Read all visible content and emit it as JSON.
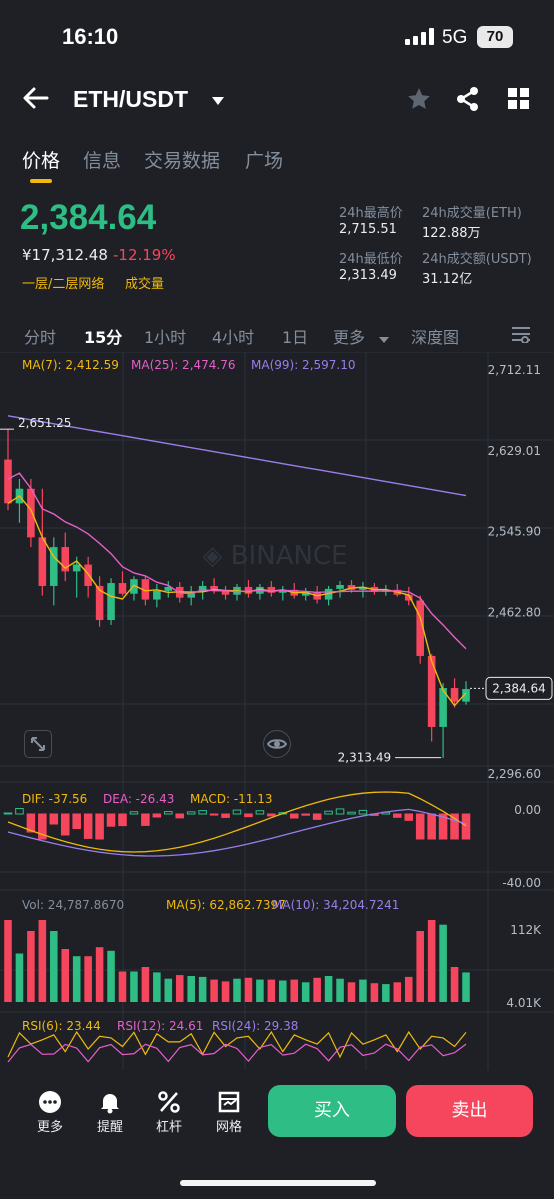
{
  "status": {
    "time": "16:10",
    "network": "5G",
    "battery": "70"
  },
  "header": {
    "pair": "ETH/USDT"
  },
  "tabs": [
    "价格",
    "信息",
    "交易数据",
    "广场"
  ],
  "price": {
    "last": "2,384.64",
    "cny": "¥17,312.48",
    "change": "-12.19%",
    "tag_layer": "一层/二层网络",
    "tag_volume": "成交量"
  },
  "stats": {
    "high_label": "24h最高价",
    "high": "2,715.51",
    "vol_eth_label": "24h成交量(ETH)",
    "vol_eth": "122.88万",
    "low_label": "24h最低价",
    "low": "2,313.49",
    "vol_usdt_label": "24h成交额(USDT)",
    "vol_usdt": "31.12亿"
  },
  "intervals": [
    "分时",
    "15分",
    "1小时",
    "4小时",
    "1日",
    "更多",
    "深度图"
  ],
  "indicators": {
    "ma7": "MA(7): 2,412.59",
    "ma25": "MA(25): 2,474.76",
    "ma99": "MA(99): 2,597.10",
    "dif": "DIF: -37.56",
    "dea": "DEA: -26.43",
    "macd": "MACD: -11.13",
    "vol": "Vol: 24,787.8670",
    "vol_ma5": "MA(5): 62,862.7397",
    "vol_ma10": "MA(10): 34,204.7241",
    "rsi6": "RSI(6): 23.44",
    "rsi12": "RSI(12): 24.61",
    "rsi24": "RSI(24): 29.38"
  },
  "colors": {
    "up": "#2ebd85",
    "down": "#f6465d",
    "ma7": "#f0b90b",
    "ma25": "#e75fc8",
    "ma99": "#9a7ee8"
  },
  "chart_data": {
    "type": "candlestick",
    "y_ticks": [
      "2,712.11",
      "2,629.01",
      "2,545.90",
      "2,462.80",
      "2,296.60"
    ],
    "ylim": [
      2296.6,
      2712.11
    ],
    "last_price_tag": "2,384.64",
    "high_marker": "2,651.25",
    "low_marker": "2,313.49",
    "candles": [
      [
        2620,
        2651,
        2568,
        2575
      ],
      [
        2575,
        2600,
        2555,
        2590
      ],
      [
        2590,
        2600,
        2530,
        2540
      ],
      [
        2540,
        2590,
        2480,
        2490
      ],
      [
        2490,
        2540,
        2470,
        2530
      ],
      [
        2530,
        2545,
        2495,
        2505
      ],
      [
        2505,
        2520,
        2478,
        2512
      ],
      [
        2512,
        2520,
        2478,
        2490
      ],
      [
        2490,
        2500,
        2448,
        2455
      ],
      [
        2455,
        2498,
        2450,
        2493
      ],
      [
        2493,
        2505,
        2480,
        2482
      ],
      [
        2482,
        2500,
        2475,
        2497
      ],
      [
        2497,
        2500,
        2470,
        2476
      ],
      [
        2476,
        2492,
        2468,
        2485
      ],
      [
        2485,
        2495,
        2478,
        2489
      ],
      [
        2489,
        2494,
        2473,
        2478
      ],
      [
        2478,
        2490,
        2470,
        2484
      ],
      [
        2484,
        2495,
        2476,
        2490
      ],
      [
        2490,
        2498,
        2482,
        2485
      ],
      [
        2485,
        2490,
        2476,
        2481
      ],
      [
        2481,
        2492,
        2475,
        2489
      ],
      [
        2489,
        2496,
        2478,
        2482
      ],
      [
        2482,
        2492,
        2476,
        2489
      ],
      [
        2489,
        2495,
        2479,
        2483
      ],
      [
        2483,
        2490,
        2475,
        2486
      ],
      [
        2486,
        2493,
        2477,
        2480
      ],
      [
        2480,
        2488,
        2475,
        2484
      ],
      [
        2484,
        2490,
        2472,
        2476
      ],
      [
        2476,
        2490,
        2470,
        2487
      ],
      [
        2487,
        2495,
        2478,
        2491
      ],
      [
        2491,
        2496,
        2483,
        2486
      ],
      [
        2486,
        2494,
        2478,
        2489
      ],
      [
        2489,
        2493,
        2481,
        2484
      ],
      [
        2484,
        2491,
        2480,
        2486
      ],
      [
        2486,
        2492,
        2479,
        2481
      ],
      [
        2481,
        2489,
        2470,
        2475
      ],
      [
        2475,
        2480,
        2410,
        2418
      ],
      [
        2418,
        2420,
        2330,
        2345
      ],
      [
        2345,
        2390,
        2313,
        2385
      ],
      [
        2385,
        2395,
        2365,
        2371
      ],
      [
        2371,
        2392,
        2368,
        2384
      ]
    ],
    "macd_labels": [
      "0.00",
      "-40.00"
    ],
    "volume_labels": [
      "112K",
      "4.01K"
    ]
  },
  "bottom": {
    "more": "更多",
    "alert": "提醒",
    "margin": "杠杆",
    "grid": "网格",
    "buy": "买入",
    "sell": "卖出"
  }
}
